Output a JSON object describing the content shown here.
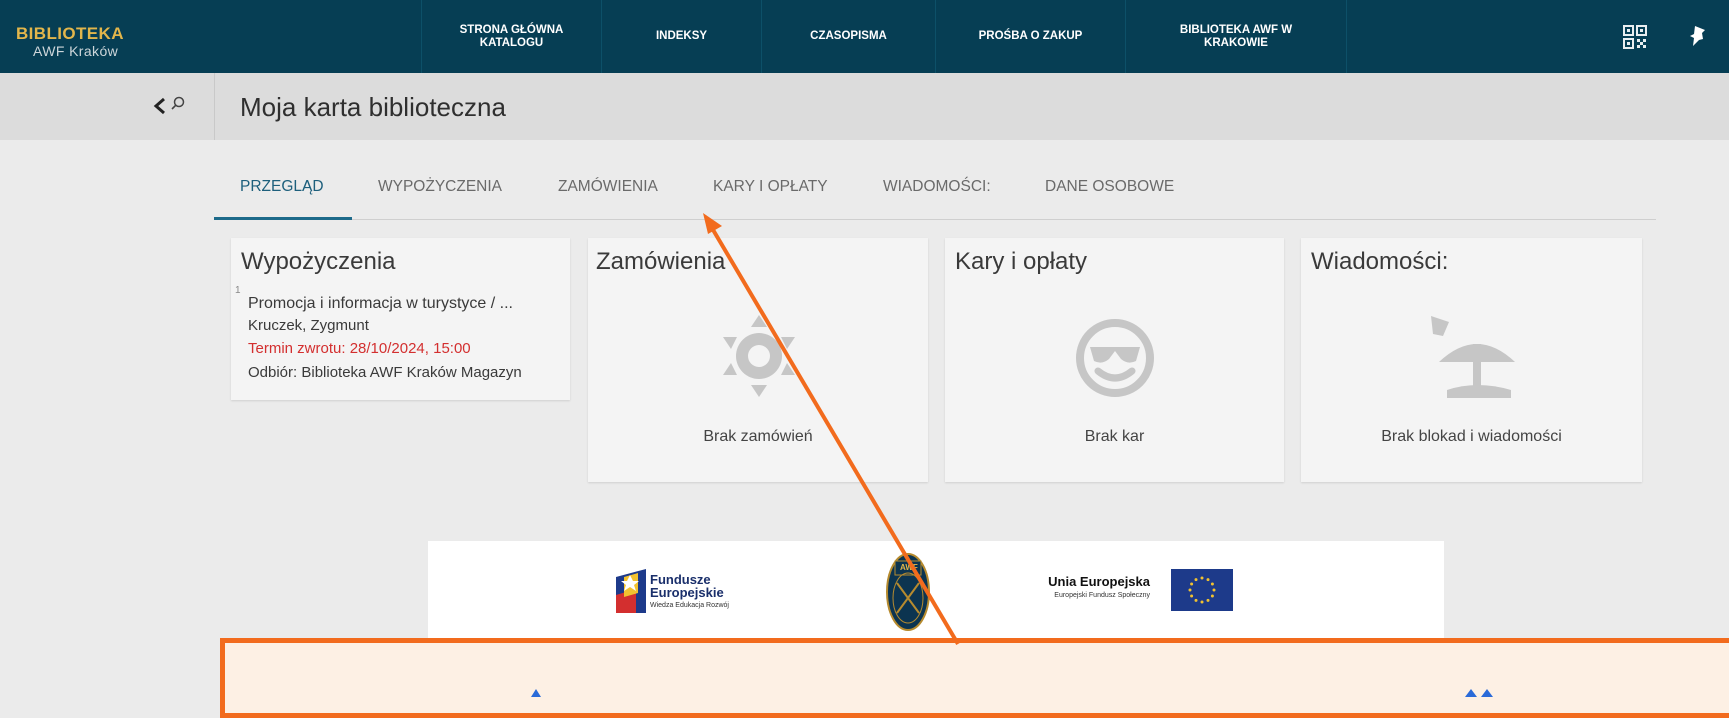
{
  "brand": {
    "line1": "BIBLIOTEKA",
    "line2": "AWF Kraków"
  },
  "nav": {
    "items": [
      {
        "line1": "STRONA GŁÓWNA",
        "line2": "KATALOGU"
      },
      {
        "line1": "INDEKSY",
        "line2": ""
      },
      {
        "line1": "CZASOPISMA",
        "line2": ""
      },
      {
        "line1": "PROŚBA O ZAKUP",
        "line2": ""
      },
      {
        "line1": "BIBLIOTEKA AWF W",
        "line2": "KRAKOWIE"
      }
    ],
    "icons": [
      "qr-code-icon",
      "pin-icon"
    ]
  },
  "header": {
    "title": "Moja karta biblioteczna",
    "toggle_icons": [
      "chevron-left-icon",
      "search-icon"
    ]
  },
  "tabs": [
    {
      "label": "PRZEGLĄD",
      "active": true
    },
    {
      "label": "WYPOŻYCZENIA",
      "active": false
    },
    {
      "label": "ZAMÓWIENIA",
      "active": false
    },
    {
      "label": "KARY I OPŁATY",
      "active": false
    },
    {
      "label": "WIADOMOŚCI:",
      "active": false
    },
    {
      "label": "DANE OSOBOWE",
      "active": false
    }
  ],
  "cards": {
    "loans": {
      "title": "Wypożyczenia",
      "item": {
        "number": "1",
        "title": "Promocja i informacja w turystyce / ...",
        "author": "Kruczek, Zygmunt",
        "due": "Termin zwrotu: 28/10/2024, 15:00",
        "pickup": "Odbiór: Biblioteka AWF Kraków Magazyn"
      }
    },
    "orders": {
      "title": "Zamówienia",
      "empty": "Brak zamówień",
      "icon": "sun-icon"
    },
    "fines": {
      "title": "Kary i opłaty",
      "empty": "Brak kar",
      "icon": "smiley-sunglasses-icon"
    },
    "messages": {
      "title": "Wiadomości:",
      "empty": "Brak blokad i wiadomości",
      "icon": "beach-umbrella-icon"
    }
  },
  "logos": {
    "fe": {
      "line1": "Fundusze",
      "line2": "Europejskie",
      "line3": "Wiedza Edukacja Rozwój"
    },
    "awf_badge": "AWF",
    "eu": {
      "line1": "Unia Europejska",
      "line2": "Europejski Fundusz Społeczny"
    }
  },
  "colors": {
    "nav_bg": "#063e54",
    "brand_gold": "#e2b64b",
    "accent": "#1d6a8a",
    "due_red": "#d32f2f",
    "annotation": "#f26b1d"
  }
}
